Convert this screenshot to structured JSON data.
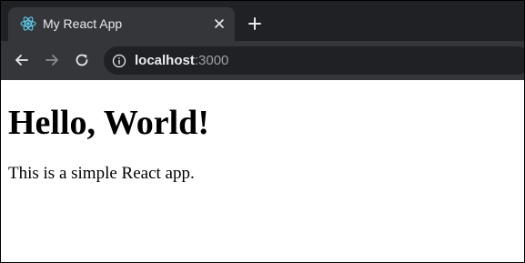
{
  "browser": {
    "tab": {
      "title": "My React App",
      "favicon": "react-logo-icon"
    },
    "new_tab_icon": "plus-icon",
    "close_tab_icon": "close-icon",
    "nav": {
      "back_icon": "back-arrow-icon",
      "forward_icon": "forward-arrow-icon",
      "reload_icon": "reload-icon"
    },
    "address_bar": {
      "host": "localhost",
      "port": ":3000",
      "info_icon": "info-icon"
    },
    "colors": {
      "tabstrip_bg": "#202124",
      "tab_bg": "#35363a",
      "toolbar_bg": "#35363a",
      "omnibox_bg": "#202124",
      "react_accent": "#61dafb"
    }
  },
  "page": {
    "heading": "Hello, World!",
    "paragraph": "This is a simple React app."
  }
}
